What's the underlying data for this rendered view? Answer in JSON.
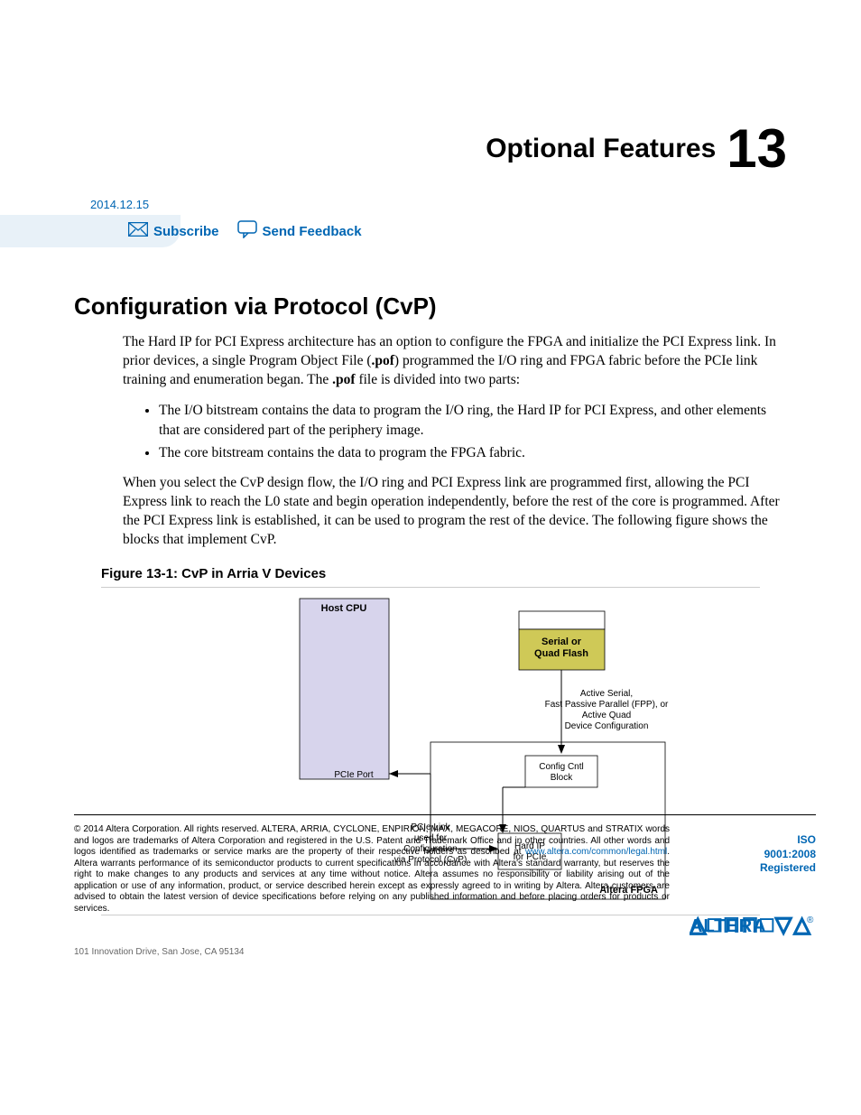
{
  "title": {
    "text": "Optional Features",
    "number": "13"
  },
  "date": "2014.12.15",
  "banner": {
    "subscribe": "Subscribe",
    "feedback": "Send Feedback"
  },
  "section": {
    "heading": "Configuration via Protocol (CvP)",
    "p1a": "The Hard IP for PCI Express architecture has an option to configure the FPGA and initialize the PCI Express link. In prior devices, a single Program Object File (",
    "p1b": ".pof",
    "p1c": ") programmed the I/O ring and FPGA fabric before the PCIe link training and enumeration began. The ",
    "p1d": ".pof",
    "p1e": " file is divided into two parts:",
    "li1": "The I/O bitstream contains the data to program the I/O ring, the Hard IP for PCI Express, and other elements that are considered part of the periphery image.",
    "li2": "The core bitstream contains the data to program the FPGA fabric.",
    "p2": "When you select the CvP design flow, the I/O ring and PCI Express link are programmed first, allowing the PCI Express link to reach the L0 state and begin operation independently, before the rest of the core is programmed. After the PCI Express link is established, it can be used to program the rest of the device. The following figure shows the blocks that implement CvP."
  },
  "figure": {
    "caption": "Figure 13-1: CvP in Arria V Devices",
    "host": "Host CPU",
    "flash": "Serial or Quad Flash",
    "flash_note": "Active Serial, Fast Passive Parallel (FPP), or Active Quad Device Configuration",
    "config": "Config Cntl Block",
    "pcie_port": "PCIe Port",
    "link_note": "PCIe Link used for Configuration via Protocol (CvP)",
    "hard_ip": "Hard IP for  PCIe",
    "fpga": "Altera FPGA"
  },
  "footer": {
    "copyright_symbol": "©",
    "text1": "2014 Altera Corporation. All rights reserved. ALTERA, ARRIA, CYCLONE, ENPIRION, MAX, MEGACORE, NIOS, QUARTUS and STRATIX words and logos are trademarks of Altera Corporation and registered in the U.S. Patent and Trademark Office and in other countries. All other words and logos identified as trademarks or service marks are the property of their respective holders as described at ",
    "link": "www.altera.com/common/legal.html",
    "text2": ". Altera warrants performance of its semiconductor products to current specifications in accordance with Altera's standard warranty, but reserves the right to make changes to any products and services at any time without notice. Altera assumes no responsibility or liability arising out of the application or use of any information, product, or service described herein except as expressly agreed to in writing by Altera. Altera customers are advised to obtain the latest version of device specifications before relying on any published information and before placing orders for products or services.",
    "iso1": "ISO",
    "iso2": "9001:2008",
    "iso3": "Registered",
    "address": "101 Innovation Drive, San Jose, CA 95134"
  }
}
